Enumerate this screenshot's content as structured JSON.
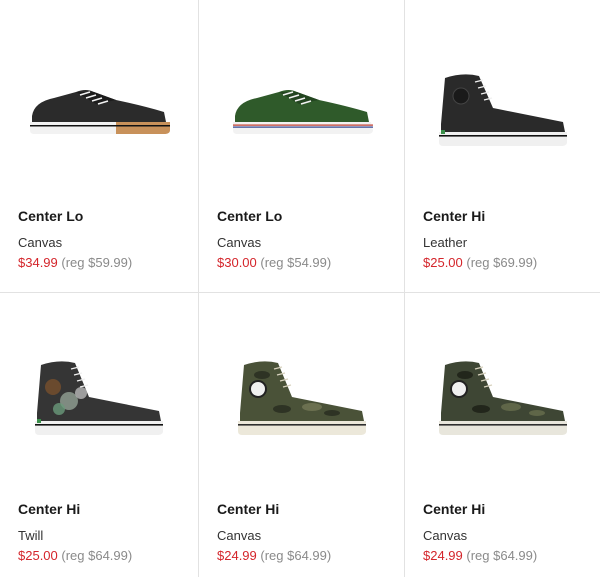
{
  "products": [
    {
      "name": "Center Lo",
      "material": "Canvas",
      "sale_price": "$34.99",
      "reg_price": "(reg $59.99)",
      "colors": {
        "upper": "#2b2b2b",
        "sole": "#f2f2f2",
        "accent": "#c8915a"
      }
    },
    {
      "name": "Center Lo",
      "material": "Canvas",
      "sale_price": "$30.00",
      "reg_price": "(reg $54.99)",
      "colors": {
        "upper": "#2f5a2a",
        "sole": "#f2f2f2",
        "accent": "#c0392b"
      }
    },
    {
      "name": "Center Hi",
      "material": "Leather",
      "sale_price": "$25.00",
      "reg_price": "(reg $69.99)",
      "colors": {
        "upper": "#2a2a2a",
        "sole": "#f0f0f0",
        "accent": "#3a8f4a"
      }
    },
    {
      "name": "Center Hi",
      "material": "Twill",
      "sale_price": "$25.00",
      "reg_price": "(reg $64.99)",
      "colors": {
        "upper": "#353535",
        "sole": "#f0f0f0",
        "accent": "#6a9a7a"
      }
    },
    {
      "name": "Center Hi",
      "material": "Canvas",
      "sale_price": "$24.99",
      "reg_price": "(reg $64.99)",
      "colors": {
        "upper": "#4a5238",
        "sole": "#ece8da",
        "accent": "#2e2e2e"
      }
    },
    {
      "name": "Center Hi",
      "material": "Canvas",
      "sale_price": "$24.99",
      "reg_price": "(reg $64.99)",
      "colors": {
        "upper": "#3e4634",
        "sole": "#e8e6dc",
        "accent": "#2e2e2e"
      }
    }
  ]
}
